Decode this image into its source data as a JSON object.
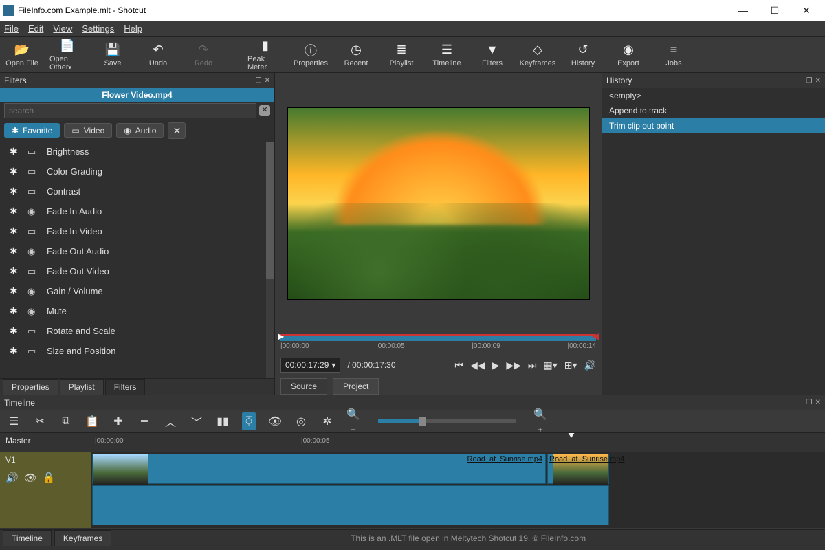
{
  "window": {
    "title": "FileInfo.com Example.mlt - Shotcut"
  },
  "menubar": [
    "File",
    "Edit",
    "View",
    "Settings",
    "Help"
  ],
  "toolbar": [
    {
      "label": "Open File",
      "icon": "📂"
    },
    {
      "label": "Open Other",
      "icon": "📄",
      "caret": true
    },
    {
      "label": "Save",
      "icon": "💾"
    },
    {
      "label": "Undo",
      "icon": "↶"
    },
    {
      "label": "Redo",
      "icon": "↷",
      "disabled": true
    },
    {
      "label": "Peak Meter",
      "icon": "▮"
    },
    {
      "label": "Properties",
      "icon": "ⓘ"
    },
    {
      "label": "Recent",
      "icon": "◷"
    },
    {
      "label": "Playlist",
      "icon": "≣"
    },
    {
      "label": "Timeline",
      "icon": "☰"
    },
    {
      "label": "Filters",
      "icon": "▼"
    },
    {
      "label": "Keyframes",
      "icon": "◇"
    },
    {
      "label": "History",
      "icon": "↺"
    },
    {
      "label": "Export",
      "icon": "◉"
    },
    {
      "label": "Jobs",
      "icon": "≡"
    }
  ],
  "filters_panel": {
    "title": "Filters",
    "clipname": "Flower Video.mp4",
    "search_placeholder": "search",
    "tabs": {
      "favorite": "Favorite",
      "video": "Video",
      "audio": "Audio"
    },
    "list": [
      {
        "name": "Brightness",
        "type": "video"
      },
      {
        "name": "Color Grading",
        "type": "video"
      },
      {
        "name": "Contrast",
        "type": "video"
      },
      {
        "name": "Fade In Audio",
        "type": "audio"
      },
      {
        "name": "Fade In Video",
        "type": "video"
      },
      {
        "name": "Fade Out Audio",
        "type": "audio"
      },
      {
        "name": "Fade Out Video",
        "type": "video"
      },
      {
        "name": "Gain / Volume",
        "type": "audio"
      },
      {
        "name": "Mute",
        "type": "audio"
      },
      {
        "name": "Rotate and Scale",
        "type": "video"
      },
      {
        "name": "Size and Position",
        "type": "video"
      }
    ],
    "bottom_tabs": [
      "Properties",
      "Playlist",
      "Filters"
    ]
  },
  "preview": {
    "timecodes": [
      "|00:00:00",
      "|00:00:05",
      "|00:00:09",
      "|00:00:14"
    ],
    "current": "00:00:17:29",
    "duration": "/ 00:00:17:30",
    "source_tab": "Source",
    "project_tab": "Project"
  },
  "history_panel": {
    "title": "History",
    "items": [
      "<empty>",
      "Append to track",
      "Trim clip out point"
    ]
  },
  "timeline": {
    "title": "Timeline",
    "ruler": {
      "t0": "|00:00:00",
      "t1": "|00:00:05"
    },
    "master": "Master",
    "v1": "V1",
    "clip1_name": "Road_at_Sunrise.mp4",
    "clip2_name": "Road_at_Sunrise.mp4",
    "bottom_tabs": [
      "Timeline",
      "Keyframes"
    ]
  },
  "statusbar": "This is an .MLT file open in Meltytech Shotcut 19. © FileInfo.com"
}
